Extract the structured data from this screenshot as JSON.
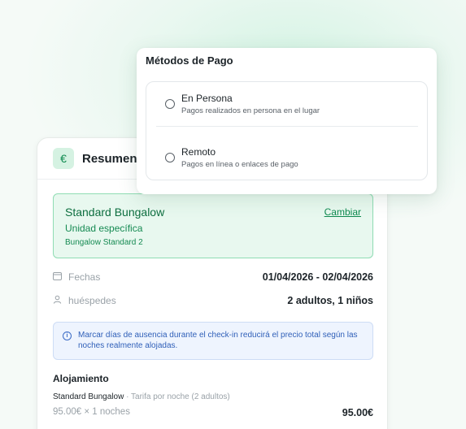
{
  "summary": {
    "title": "Resumen d",
    "currency_icon": "€",
    "room": {
      "name": "Standard Bungalow",
      "type": "Unidad específica",
      "unit": "Bungalow Standard 2",
      "change_label": "Cambiar"
    },
    "dates": {
      "label": "Fechas",
      "value": "01/04/2026 - 02/04/2026"
    },
    "guests": {
      "label": "huéspedes",
      "value": "2 adultos, 1 niños"
    },
    "info_text": "Marcar días de ausencia durante el check-in reducirá el precio total según las noches realmente alojadas.",
    "lodging": {
      "title": "Alojamiento",
      "room_name": "Standard Bungalow",
      "rate_note": " · Tarifa por noche (2 adultos)",
      "calc": "95.00€ × 1 noches",
      "total": "95.00€"
    }
  },
  "payment_methods": {
    "title": "Métodos de Pago",
    "options": [
      {
        "label": "En Persona",
        "description": "Pagos realizados en persona en el lugar",
        "selected": false
      },
      {
        "label": "Remoto",
        "description": "Pagos en línea o enlaces de pago",
        "selected": false
      }
    ]
  }
}
